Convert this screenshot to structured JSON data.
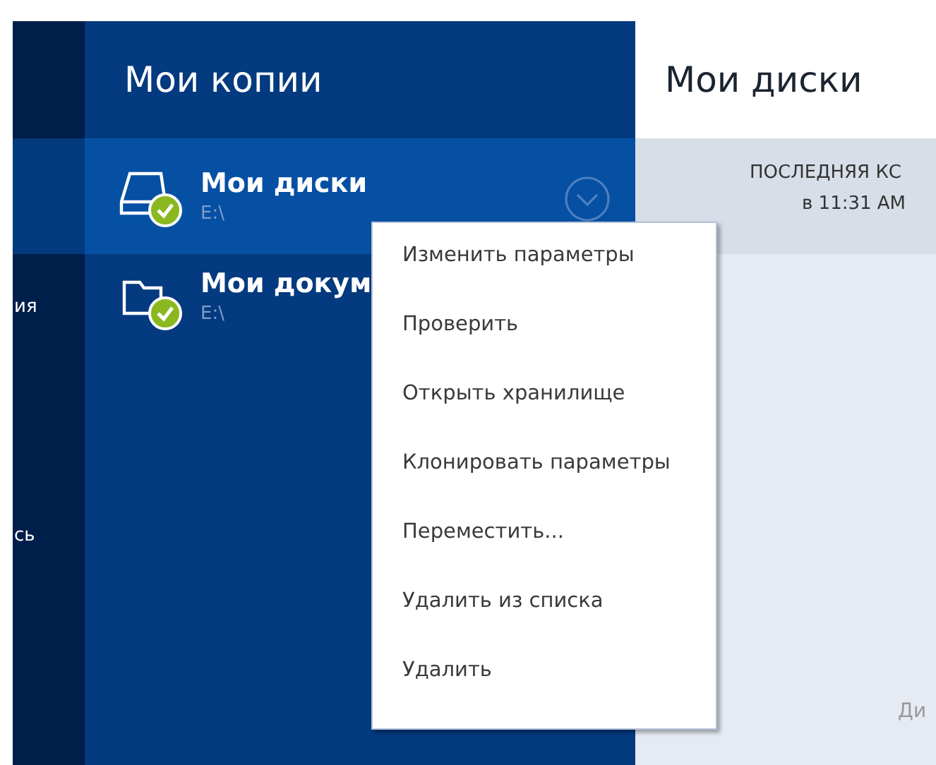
{
  "sidebar": {
    "items": [
      {
        "selected": true
      },
      {
        "label": "ия",
        "selected": false
      },
      {
        "label": "сь",
        "selected": false
      }
    ]
  },
  "backups": {
    "title": "Мои копии",
    "items": [
      {
        "kind": "disk",
        "name": "Мои диски",
        "path": "E:\\",
        "selected": true,
        "ok": true
      },
      {
        "kind": "folder",
        "name": "Мои докум",
        "path": "E:\\",
        "selected": false,
        "ok": true
      }
    ]
  },
  "details": {
    "title": "Мои диски",
    "status": "ПОСЛЕДНЯЯ КС",
    "time": "в 11:31 AM",
    "footer": "Ди"
  },
  "context_menu": {
    "items": [
      "Изменить параметры",
      "Проверить",
      "Открыть хранилище",
      "Клонировать параметры",
      "Переместить...",
      "Удалить из списка",
      "Удалить"
    ]
  }
}
